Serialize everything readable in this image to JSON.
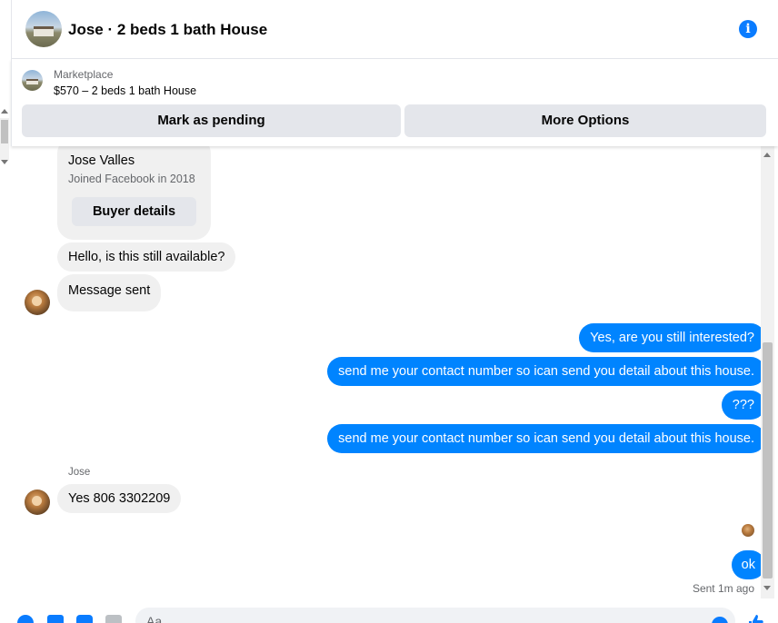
{
  "header": {
    "title": "Jose · 2 beds 1 bath House"
  },
  "marketplace": {
    "label": "Marketplace",
    "listing": "$570 – 2 beds 1 bath House",
    "mark_pending": "Mark as pending",
    "more_options": "More Options"
  },
  "profile_card": {
    "name": "Jose Valles",
    "joined": "Joined Facebook in 2018",
    "buyer_details": "Buyer details"
  },
  "messages": [
    {
      "from": "buyer",
      "text": "Hello, is this still available?"
    },
    {
      "from": "buyer",
      "text": "Message sent"
    },
    {
      "from": "me",
      "text": "Yes, are you still interested?"
    },
    {
      "from": "me",
      "text": "send me your contact number so ican send you detail about this house."
    },
    {
      "from": "me",
      "text": "???"
    },
    {
      "from": "me",
      "text": "send me your contact number so ican send you detail about this house."
    },
    {
      "from": "buyer",
      "text": "Yes 806 3302209"
    },
    {
      "from": "me",
      "text": "ok"
    }
  ],
  "sender_name": "Jose",
  "status": "Sent 1m ago",
  "composer": {
    "placeholder": "Aa"
  },
  "colors": {
    "accent": "#0084ff",
    "incoming_bubble": "#f0f0f0",
    "button_bg": "#e4e6eb"
  },
  "icons": [
    "info-icon",
    "plus-icon",
    "photo-icon",
    "sticker-icon",
    "gif-icon",
    "emoji-icon",
    "thumbs-up-icon"
  ]
}
